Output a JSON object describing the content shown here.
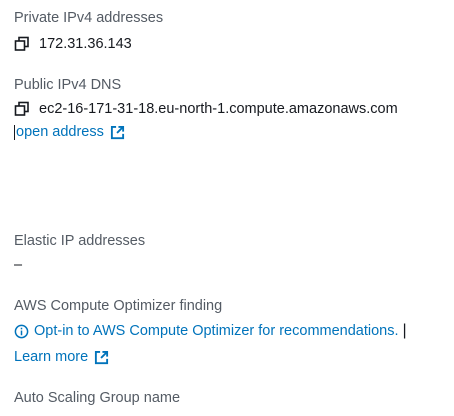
{
  "private_ipv4": {
    "label": "Private IPv4 addresses",
    "value": "172.31.36.143"
  },
  "public_dns": {
    "label": "Public IPv4 DNS",
    "value": "ec2-16-171-31-18.eu-north-1.compute.amazonaws.com",
    "link_label": "open address"
  },
  "elastic_ip": {
    "label": "Elastic IP addresses",
    "value": "–"
  },
  "compute_optimizer": {
    "label": "AWS Compute Optimizer finding",
    "link_label": "Opt-in to AWS Compute Optimizer for recommendations.",
    "separator": "|",
    "learn_more_label": "Learn more"
  },
  "auto_scaling": {
    "label": "Auto Scaling Group name"
  },
  "colors": {
    "link": "#0073bb",
    "label": "#545b64",
    "text": "#16191f"
  }
}
